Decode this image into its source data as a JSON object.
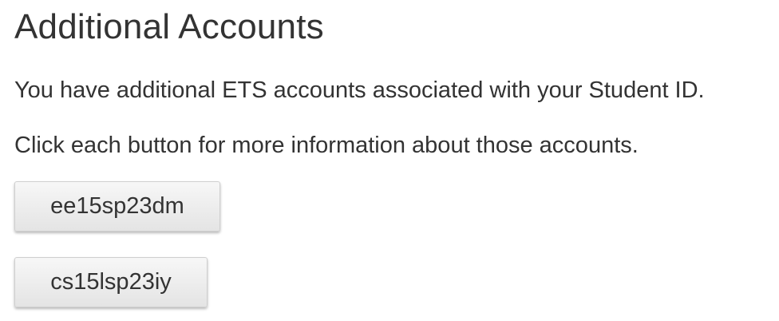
{
  "page": {
    "title": "Additional Accounts",
    "intro": "You have additional ETS accounts associated with your Student ID.",
    "instruction": "Click each button for more information about those accounts."
  },
  "accounts": [
    {
      "label": "ee15sp23dm"
    },
    {
      "label": "cs15lsp23iy"
    }
  ]
}
